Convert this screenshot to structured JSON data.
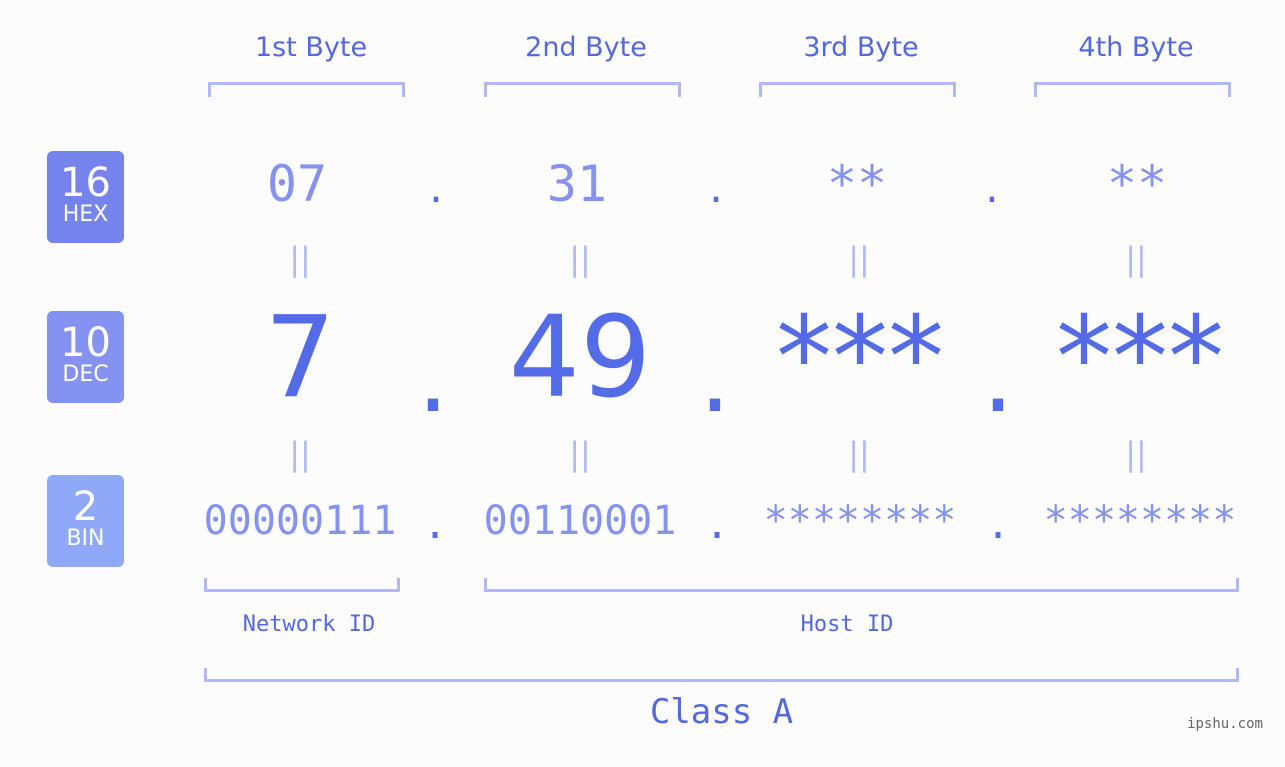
{
  "bytes": [
    {
      "label": "1st Byte",
      "hex": "07",
      "dec": "7",
      "bin": "00000111"
    },
    {
      "label": "2nd Byte",
      "hex": "31",
      "dec": "49",
      "bin": "00110001"
    },
    {
      "label": "3rd Byte",
      "hex": "**",
      "dec": "***",
      "bin": "********"
    },
    {
      "label": "4th Byte",
      "hex": "**",
      "dec": "***",
      "bin": "********"
    }
  ],
  "badges": {
    "hex": {
      "num": "16",
      "name": "HEX",
      "color": "#7584ec"
    },
    "dec": {
      "num": "10",
      "name": "DEC",
      "color": "#8492f1"
    },
    "bin": {
      "num": "2",
      "name": "BIN",
      "color": "#8fa8f8"
    }
  },
  "separator": ".",
  "equals": "||",
  "network_id_label": "Network ID",
  "host_id_label": "Host ID",
  "class_label": "Class A",
  "watermark": "ipshu.com",
  "colors": {
    "accent": "#546be8",
    "light_value": "#8592ef",
    "bracket": "#b0b9f6",
    "label": "#5468e0"
  }
}
